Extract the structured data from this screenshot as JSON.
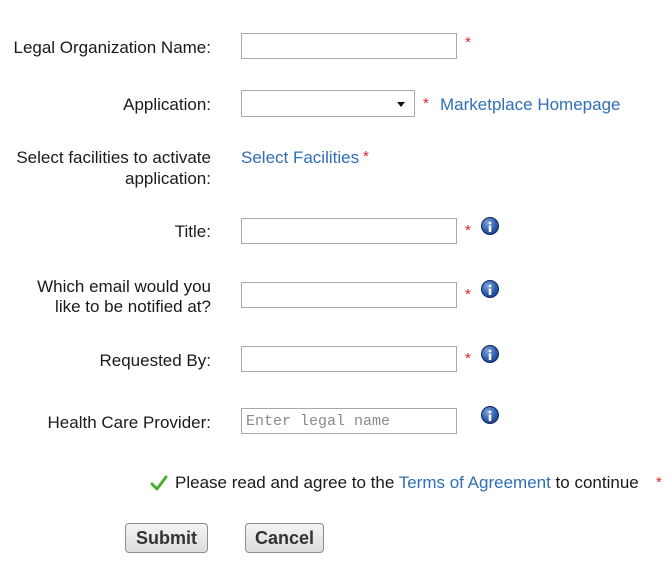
{
  "form": {
    "legal_org": {
      "label": "Legal Organization Name:",
      "value": ""
    },
    "application": {
      "label": "Application:",
      "selected": "",
      "link": "Marketplace Homepage"
    },
    "facilities": {
      "label_line1": "Select facilities to activate",
      "label_line2": "application:",
      "link": "Select Facilities"
    },
    "title": {
      "label": "Title:",
      "value": ""
    },
    "email": {
      "label_line1": "Which email would you",
      "label_line2": "like to be notified at?",
      "value": ""
    },
    "requested_by": {
      "label": "Requested By:",
      "value": ""
    },
    "provider": {
      "label": "Health Care Provider:",
      "placeholder": "Enter legal name",
      "value": ""
    },
    "required_marker": "*"
  },
  "terms": {
    "prefix": "Please read and agree to the ",
    "link": "Terms of Agreement",
    "suffix": " to continue"
  },
  "buttons": {
    "submit": "Submit",
    "cancel": "Cancel"
  },
  "colors": {
    "link": "#2f6fb5",
    "required": "#d9252a",
    "check": "#4caf2f",
    "info": "#2c5aa7"
  },
  "icons": {
    "info": "info-icon",
    "check": "checkmark-icon",
    "caret": "chevron-down-icon"
  }
}
